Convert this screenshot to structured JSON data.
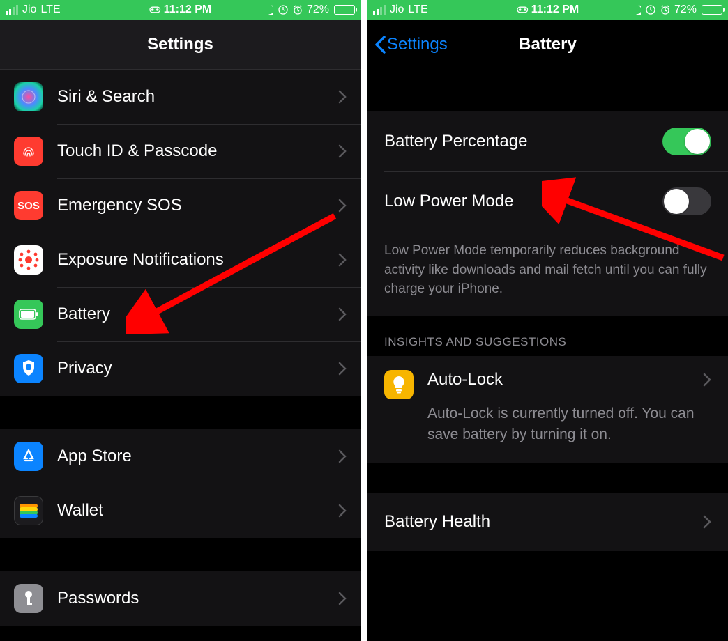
{
  "status": {
    "carrier": "Jio",
    "network": "LTE",
    "time": "11:12 PM",
    "battery_pct": "72%"
  },
  "left": {
    "title": "Settings",
    "rows": [
      {
        "id": "siri",
        "label": "Siri & Search"
      },
      {
        "id": "touchid",
        "label": "Touch ID & Passcode"
      },
      {
        "id": "sos",
        "label": "Emergency SOS"
      },
      {
        "id": "exposure",
        "label": "Exposure Notifications"
      },
      {
        "id": "battery",
        "label": "Battery"
      },
      {
        "id": "privacy",
        "label": "Privacy"
      }
    ],
    "rows2": [
      {
        "id": "appstore",
        "label": "App Store"
      },
      {
        "id": "wallet",
        "label": "Wallet"
      }
    ],
    "rows3": [
      {
        "id": "passwords",
        "label": "Passwords"
      }
    ]
  },
  "right": {
    "back": "Settings",
    "title": "Battery",
    "battery_percentage_label": "Battery Percentage",
    "low_power_label": "Low Power Mode",
    "low_power_desc": "Low Power Mode temporarily reduces background activity like downloads and mail fetch until you can fully charge your iPhone.",
    "insights_header": "INSIGHTS AND SUGGESTIONS",
    "autolock_label": "Auto-Lock",
    "autolock_desc": "Auto-Lock is currently turned off. You can save battery by turning it on.",
    "battery_health_label": "Battery Health"
  }
}
